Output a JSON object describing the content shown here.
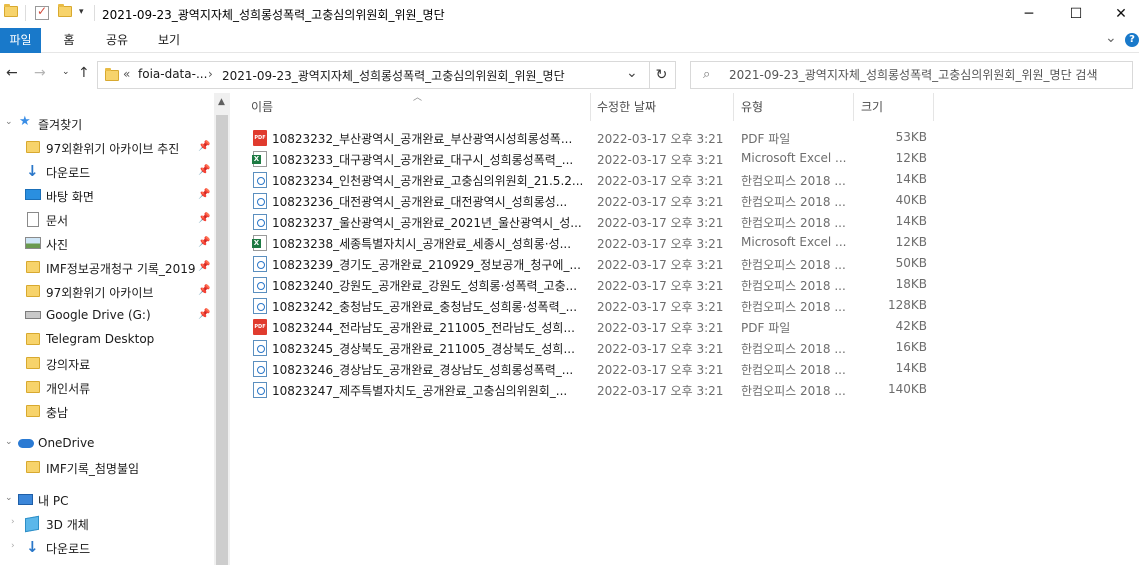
{
  "window": {
    "title": "2021-09-23_광역지자체_성희롱성폭력_고충심의위원회_위원_명단",
    "minimize": "─",
    "maximize": "☐",
    "close": "✕"
  },
  "ribbon": {
    "tabs": [
      "파일",
      "홈",
      "공유",
      "보기"
    ],
    "expand": "⌄",
    "help": "?"
  },
  "address": {
    "crumb_prefix": "«",
    "crumb1": "foia-data-...",
    "sep": "›",
    "crumb2": "2021-09-23_광역지자체_성희롱성폭력_고충심의위원회_위원_명단",
    "dropdown": "⌄",
    "refresh": "↻"
  },
  "search": {
    "placeholder": "2021-09-23_광역지자체_성희롱성폭력_고충심의위원회_위원_명단 검색"
  },
  "nav": {
    "quick_access": "즐겨찾기",
    "pinned": [
      {
        "label": "97외환위기 아카이브 추진",
        "icon": "folder"
      },
      {
        "label": "다운로드",
        "icon": "download"
      },
      {
        "label": "바탕 화면",
        "icon": "desktop"
      },
      {
        "label": "문서",
        "icon": "document"
      },
      {
        "label": "사진",
        "icon": "pictures"
      },
      {
        "label": "IMF정보공개청구 기록_2019",
        "icon": "folder"
      },
      {
        "label": "97외환위기 아카이브",
        "icon": "folder"
      },
      {
        "label": "Google Drive (G:)",
        "icon": "drive"
      }
    ],
    "unpinned": [
      "Telegram Desktop",
      "강의자료",
      "개인서류",
      "충남"
    ],
    "onedrive": "OneDrive",
    "onedrive_items": [
      "IMF기록_첨명불임"
    ],
    "thispc": "내 PC",
    "thispc_items": [
      {
        "label": "3D 개체",
        "icon": "3d"
      },
      {
        "label": "다운로드",
        "icon": "download"
      }
    ]
  },
  "columns": {
    "name": "이름",
    "date": "수정한 날짜",
    "type": "유형",
    "size": "크기"
  },
  "files": [
    {
      "name": "10823232_부산광역시_공개완료_부산광역시성희롱성폭...",
      "date": "2022-03-17 오후 3:21",
      "type": "PDF 파일",
      "size": "53KB",
      "icon": "pdf"
    },
    {
      "name": "10823233_대구광역시_공개완료_대구시_성희롱성폭력_...",
      "date": "2022-03-17 오후 3:21",
      "type": "Microsoft Excel ...",
      "size": "12KB",
      "icon": "xls"
    },
    {
      "name": "10823234_인천광역시_공개완료_고충심의위원회_21.5.2...",
      "date": "2022-03-17 오후 3:21",
      "type": "한컴오피스 2018 ...",
      "size": "14KB",
      "icon": "hwp"
    },
    {
      "name": "10823236_대전광역시_공개완료_대전광역시_성희롱성...",
      "date": "2022-03-17 오후 3:21",
      "type": "한컴오피스 2018 ...",
      "size": "40KB",
      "icon": "hwp"
    },
    {
      "name": "10823237_울산광역시_공개완료_2021년_울산광역시_성...",
      "date": "2022-03-17 오후 3:21",
      "type": "한컴오피스 2018 ...",
      "size": "14KB",
      "icon": "hwp"
    },
    {
      "name": "10823238_세종특별자치시_공개완료_세종시_성희롱·성...",
      "date": "2022-03-17 오후 3:21",
      "type": "Microsoft Excel ...",
      "size": "12KB",
      "icon": "xls"
    },
    {
      "name": "10823239_경기도_공개완료_210929_정보공개_청구에_...",
      "date": "2022-03-17 오후 3:21",
      "type": "한컴오피스 2018 ...",
      "size": "50KB",
      "icon": "hwp"
    },
    {
      "name": "10823240_강원도_공개완료_강원도_성희롱·성폭력_고충...",
      "date": "2022-03-17 오후 3:21",
      "type": "한컴오피스 2018 ...",
      "size": "18KB",
      "icon": "hwp"
    },
    {
      "name": "10823242_충청남도_공개완료_충청남도_성희롱·성폭력_...",
      "date": "2022-03-17 오후 3:21",
      "type": "한컴오피스 2018 ...",
      "size": "128KB",
      "icon": "hwp"
    },
    {
      "name": "10823244_전라남도_공개완료_211005_전라남도_성희...",
      "date": "2022-03-17 오후 3:21",
      "type": "PDF 파일",
      "size": "42KB",
      "icon": "pdf"
    },
    {
      "name": "10823245_경상북도_공개완료_211005_경상북도_성희...",
      "date": "2022-03-17 오후 3:21",
      "type": "한컴오피스 2018 ...",
      "size": "16KB",
      "icon": "hwp"
    },
    {
      "name": "10823246_경상남도_공개완료_경상남도_성희롱성폭력_...",
      "date": "2022-03-17 오후 3:21",
      "type": "한컴오피스 2018 ...",
      "size": "14KB",
      "icon": "hwp"
    },
    {
      "name": "10823247_제주특별자치도_공개완료_고충심의위원회_...",
      "date": "2022-03-17 오후 3:21",
      "type": "한컴오피스 2018 ...",
      "size": "140KB",
      "icon": "hwp"
    }
  ],
  "colors": {
    "accent": "#1979ca",
    "folder": "#f7d36b",
    "pdf": "#e03b2e",
    "excel": "#1d7a43",
    "hwp": "#2a77c9"
  }
}
